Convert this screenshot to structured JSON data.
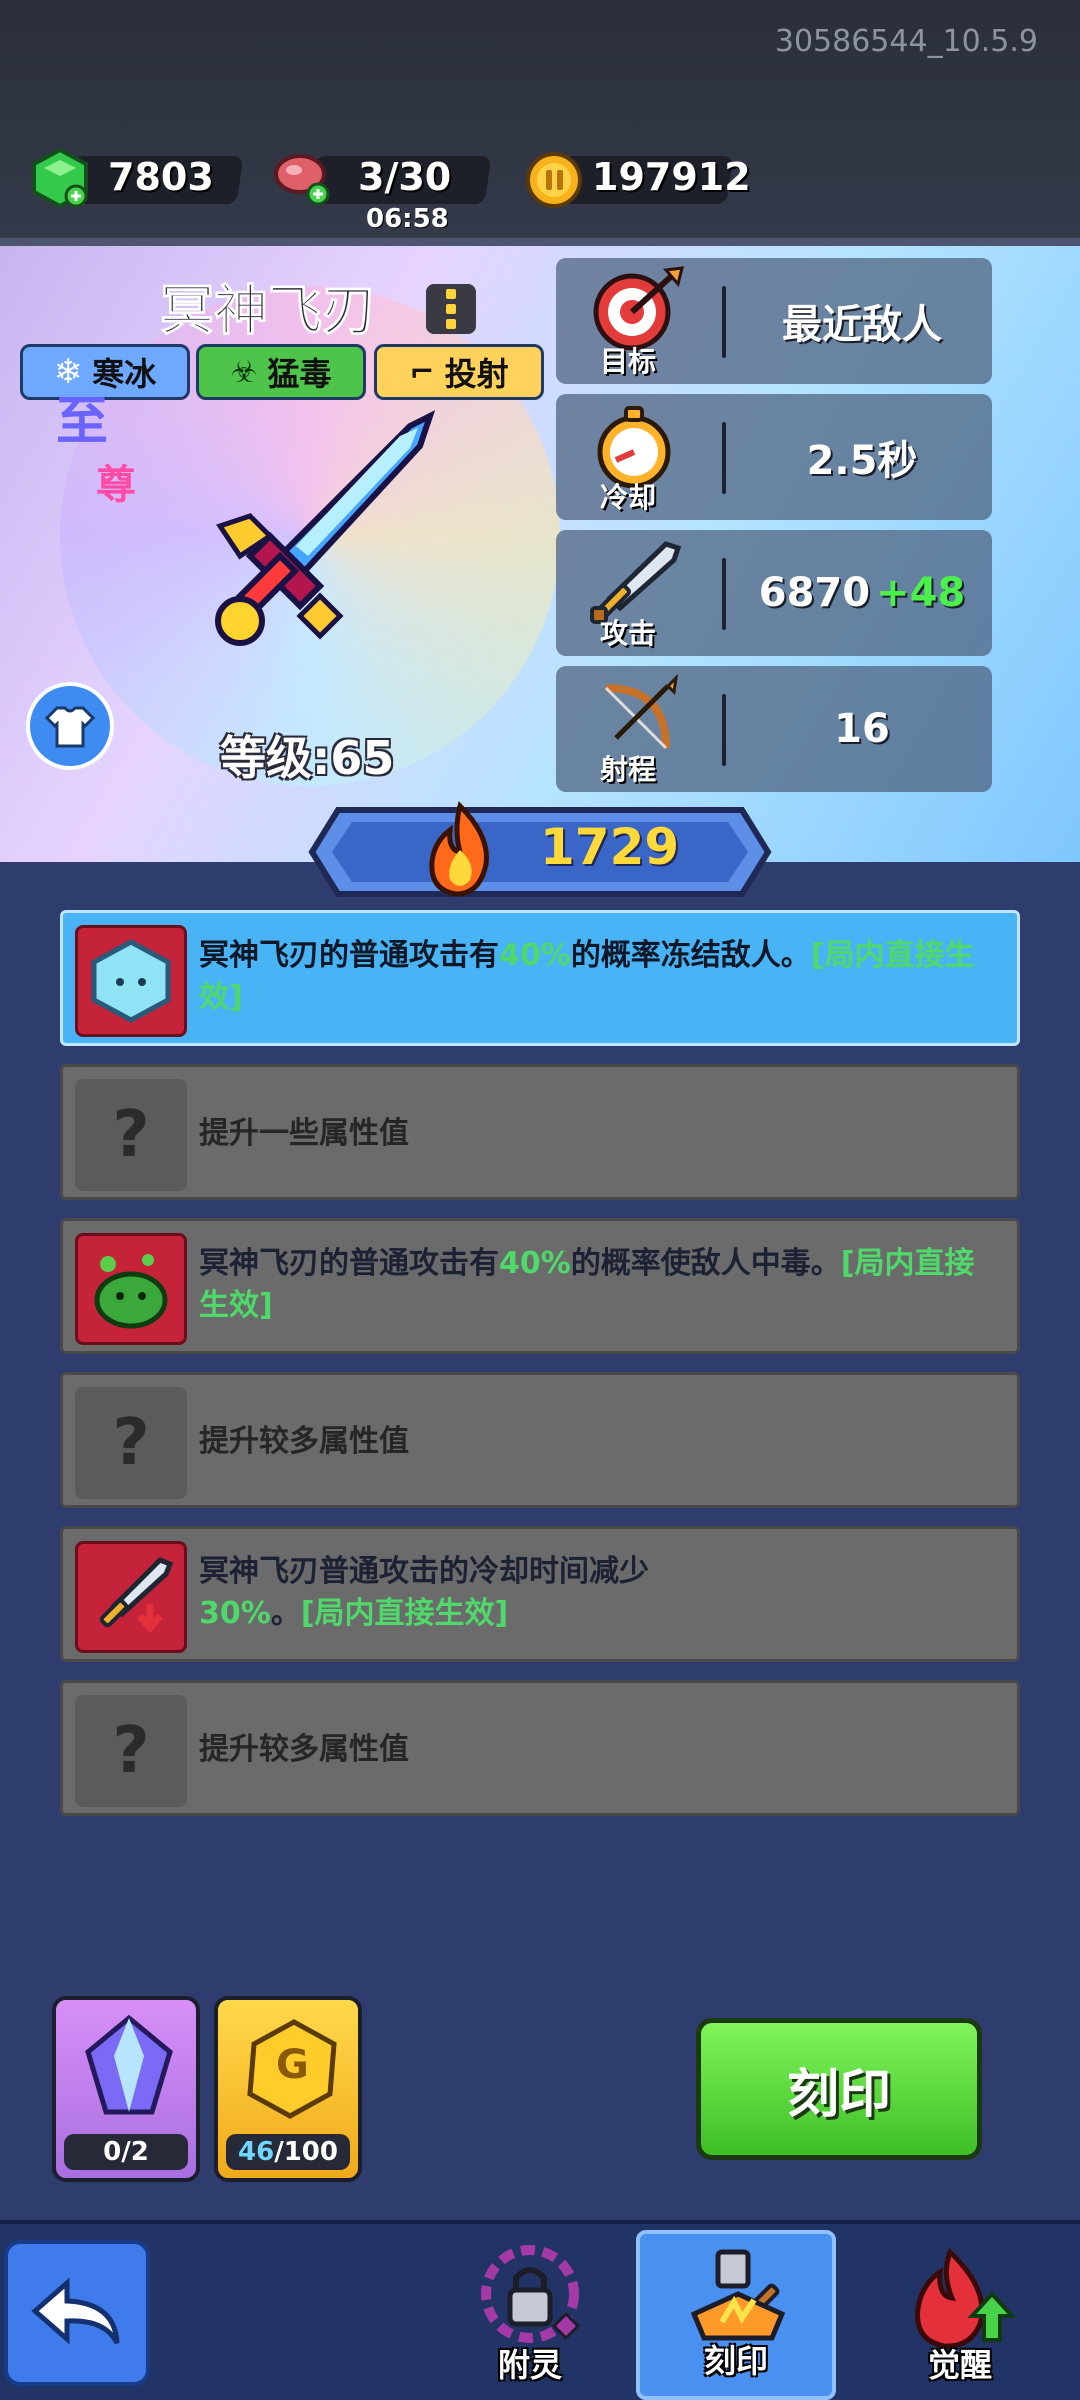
{
  "build_id": "30586544_10.5.9",
  "resources": {
    "gems": "7803",
    "energy": "3/30",
    "energy_timer": "06:58",
    "coins": "197912"
  },
  "weapon": {
    "name": "冥神飞刃",
    "tags": [
      "寒冰",
      "猛毒",
      "投射"
    ],
    "rank_line1": "至",
    "rank_line2": "尊",
    "level_text": "等级:65",
    "power": "1729"
  },
  "stats": [
    {
      "label": "目标",
      "value": "最近敌人",
      "bonus": ""
    },
    {
      "label": "冷却",
      "value": "2.5秒",
      "bonus": ""
    },
    {
      "label": "攻击",
      "value": "6870",
      "bonus": "+48"
    },
    {
      "label": "射程",
      "value": "16",
      "bonus": ""
    }
  ],
  "perks": [
    {
      "pre": "冥神飞刃的普通攻击有",
      "hl": "40%",
      "post": "的概率冻结敌人。",
      "effect": "[局内直接生效]"
    },
    {
      "text": "提升一些属性值"
    },
    {
      "pre": "冥神飞刃的普通攻击有",
      "hl": "40%",
      "post": "的概率使敌人中毒。",
      "effect": "[局内直接生效]"
    },
    {
      "text": "提升较多属性值"
    },
    {
      "pre": "冥神飞刃普通攻击的冷却时间减少",
      "hl": "30%",
      "post": "。",
      "effect": "[局内直接生效]"
    },
    {
      "text": "提升较多属性值"
    }
  ],
  "unknown_icon": "?",
  "slots": {
    "crystal_current": "0",
    "crystal_total": "/2",
    "gold_current": "46",
    "gold_total": "/100",
    "gold_letter": "G"
  },
  "engrave_button": "刻印",
  "nav": {
    "enchant": "附灵",
    "engrave": "刻印",
    "awaken": "觉醒"
  },
  "colors": {
    "active_perk": "#48b4f5",
    "inactive_perk": "#6b6b6b",
    "highlight_green": "#4fd96a",
    "power_gold": "#ffd83a",
    "engrave_green": "#5fdc3a"
  },
  "icons": [
    "gem-icon",
    "meat-icon",
    "coin-icon",
    "target-icon",
    "stopwatch-icon",
    "sword-icon",
    "bow-icon",
    "fire-icon",
    "back-arrow-icon"
  ]
}
